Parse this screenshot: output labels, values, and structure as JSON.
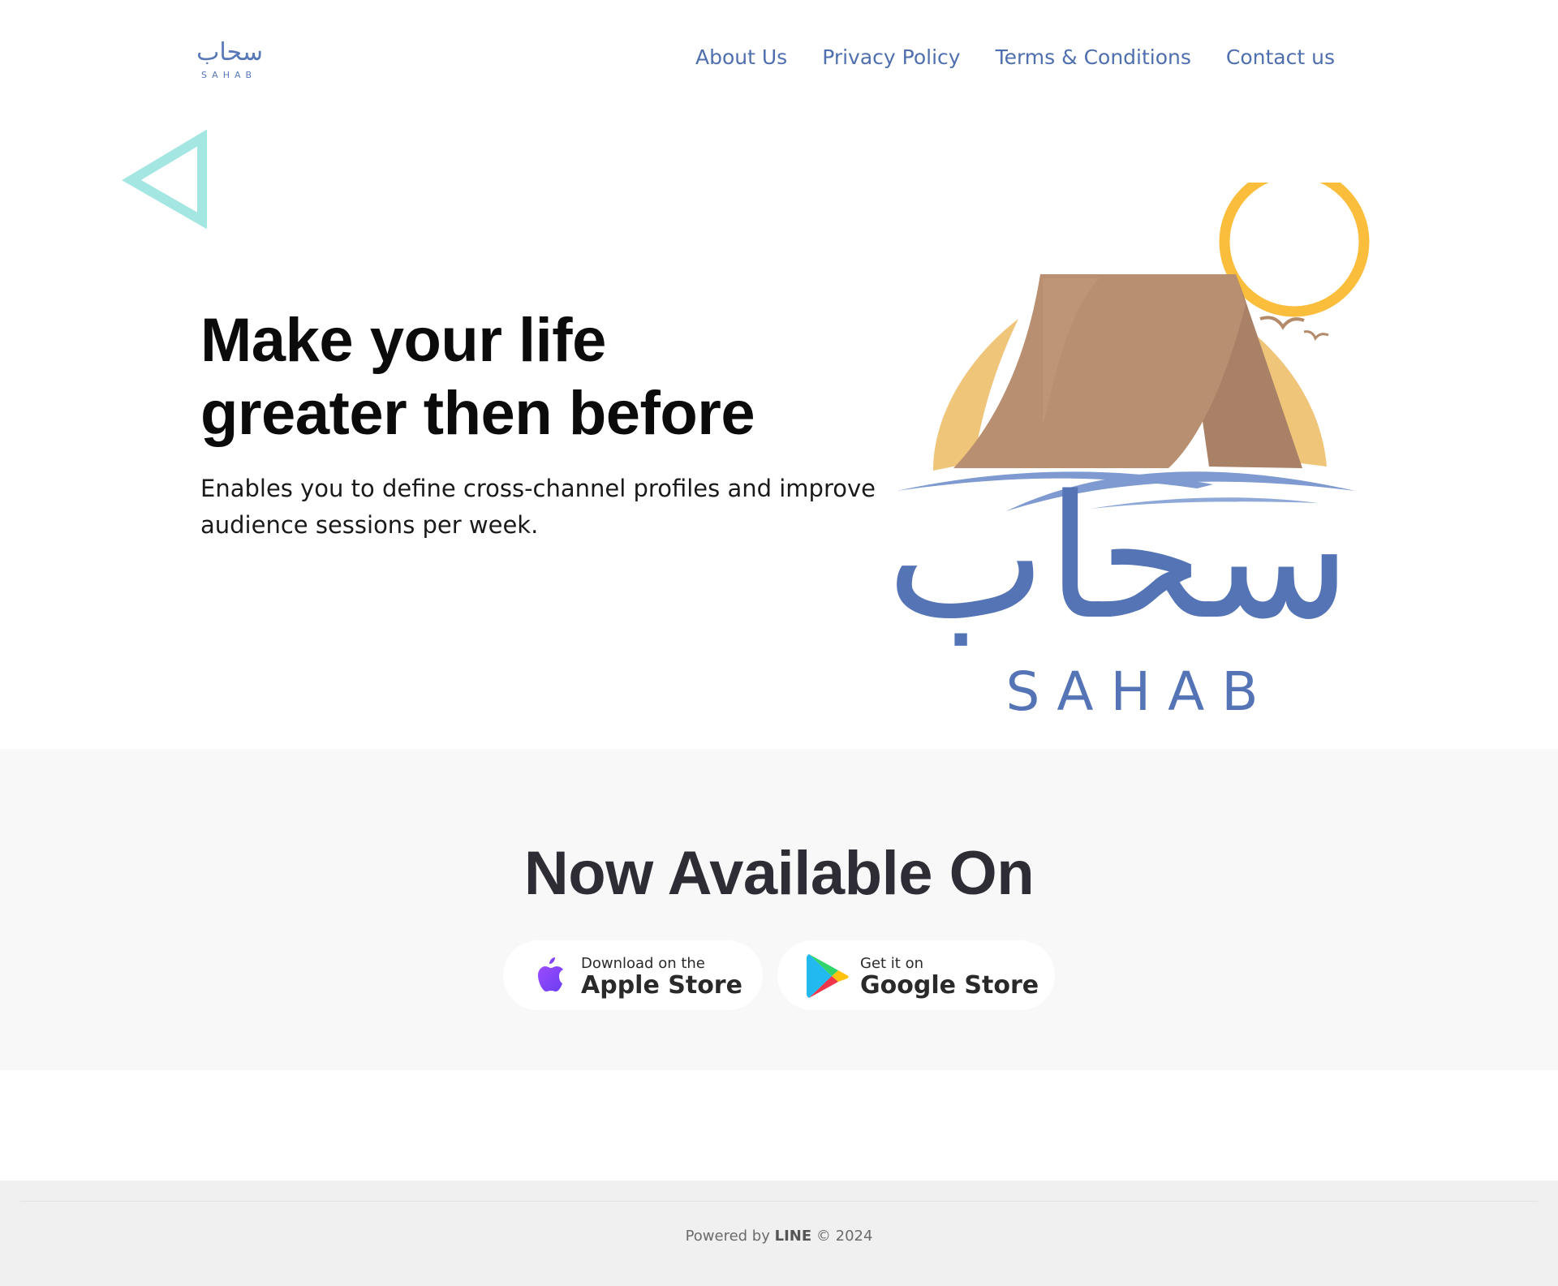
{
  "header": {
    "logo": {
      "arabic": "سحاب",
      "latin": "SAHAB"
    },
    "nav": [
      {
        "label": "About Us"
      },
      {
        "label": "Privacy Policy"
      },
      {
        "label": "Terms & Conditions"
      },
      {
        "label": "Contact us"
      }
    ]
  },
  "hero": {
    "title_line1": "Make your life",
    "title_line2": "greater then before",
    "subtitle": "Enables you to define cross-channel profiles and improve audience sessions per week.",
    "art": {
      "arabic": "سحاب",
      "latin": "S A H A B"
    }
  },
  "available": {
    "heading": "Now Available On",
    "apple": {
      "small": "Download on the",
      "big": "Apple Store",
      "icon": "apple-icon"
    },
    "google": {
      "small": "Get it on",
      "big": "Google Store",
      "icon": "google-play-icon"
    }
  },
  "footer": {
    "prefix": "Powered by",
    "brand": "LINE",
    "suffix": "© 2024"
  },
  "colors": {
    "nav_link": "#4f6fae",
    "brand_blue": "#5878b8",
    "sun": "#fbbd3c",
    "tent": "#b98f71",
    "triangle": "#a3e6e2",
    "section_bg": "#f8f8f8",
    "footer_bg": "#f0f0f0"
  }
}
